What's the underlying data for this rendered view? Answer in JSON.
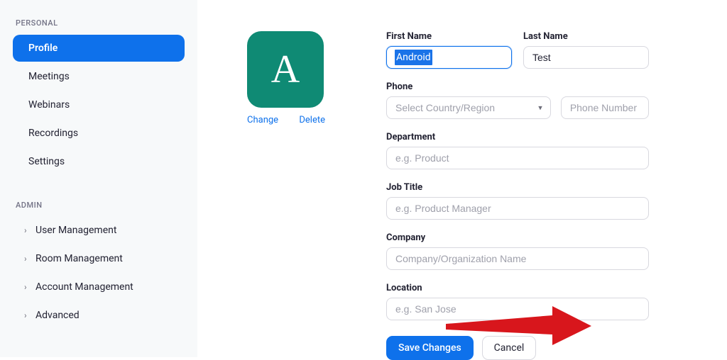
{
  "sidebar": {
    "sections": [
      {
        "header": "PERSONAL",
        "items": [
          "Profile",
          "Meetings",
          "Webinars",
          "Recordings",
          "Settings"
        ]
      },
      {
        "header": "ADMIN",
        "items": [
          "User Management",
          "Room Management",
          "Account Management",
          "Advanced"
        ]
      }
    ]
  },
  "profile": {
    "avatar_letter": "A",
    "avatar_change": "Change",
    "avatar_delete": "Delete",
    "first_name_label": "First Name",
    "first_name_value": "Android",
    "last_name_label": "Last Name",
    "last_name_value": "Test",
    "phone_label": "Phone",
    "phone_country_placeholder": "Select Country/Region",
    "phone_number_placeholder": "Phone Number",
    "department_label": "Department",
    "department_placeholder": "e.g. Product",
    "job_title_label": "Job Title",
    "job_title_placeholder": "e.g. Product Manager",
    "company_label": "Company",
    "company_placeholder": "Company/Organization Name",
    "location_label": "Location",
    "location_placeholder": "e.g. San Jose",
    "save_label": "Save Changes",
    "cancel_label": "Cancel"
  }
}
